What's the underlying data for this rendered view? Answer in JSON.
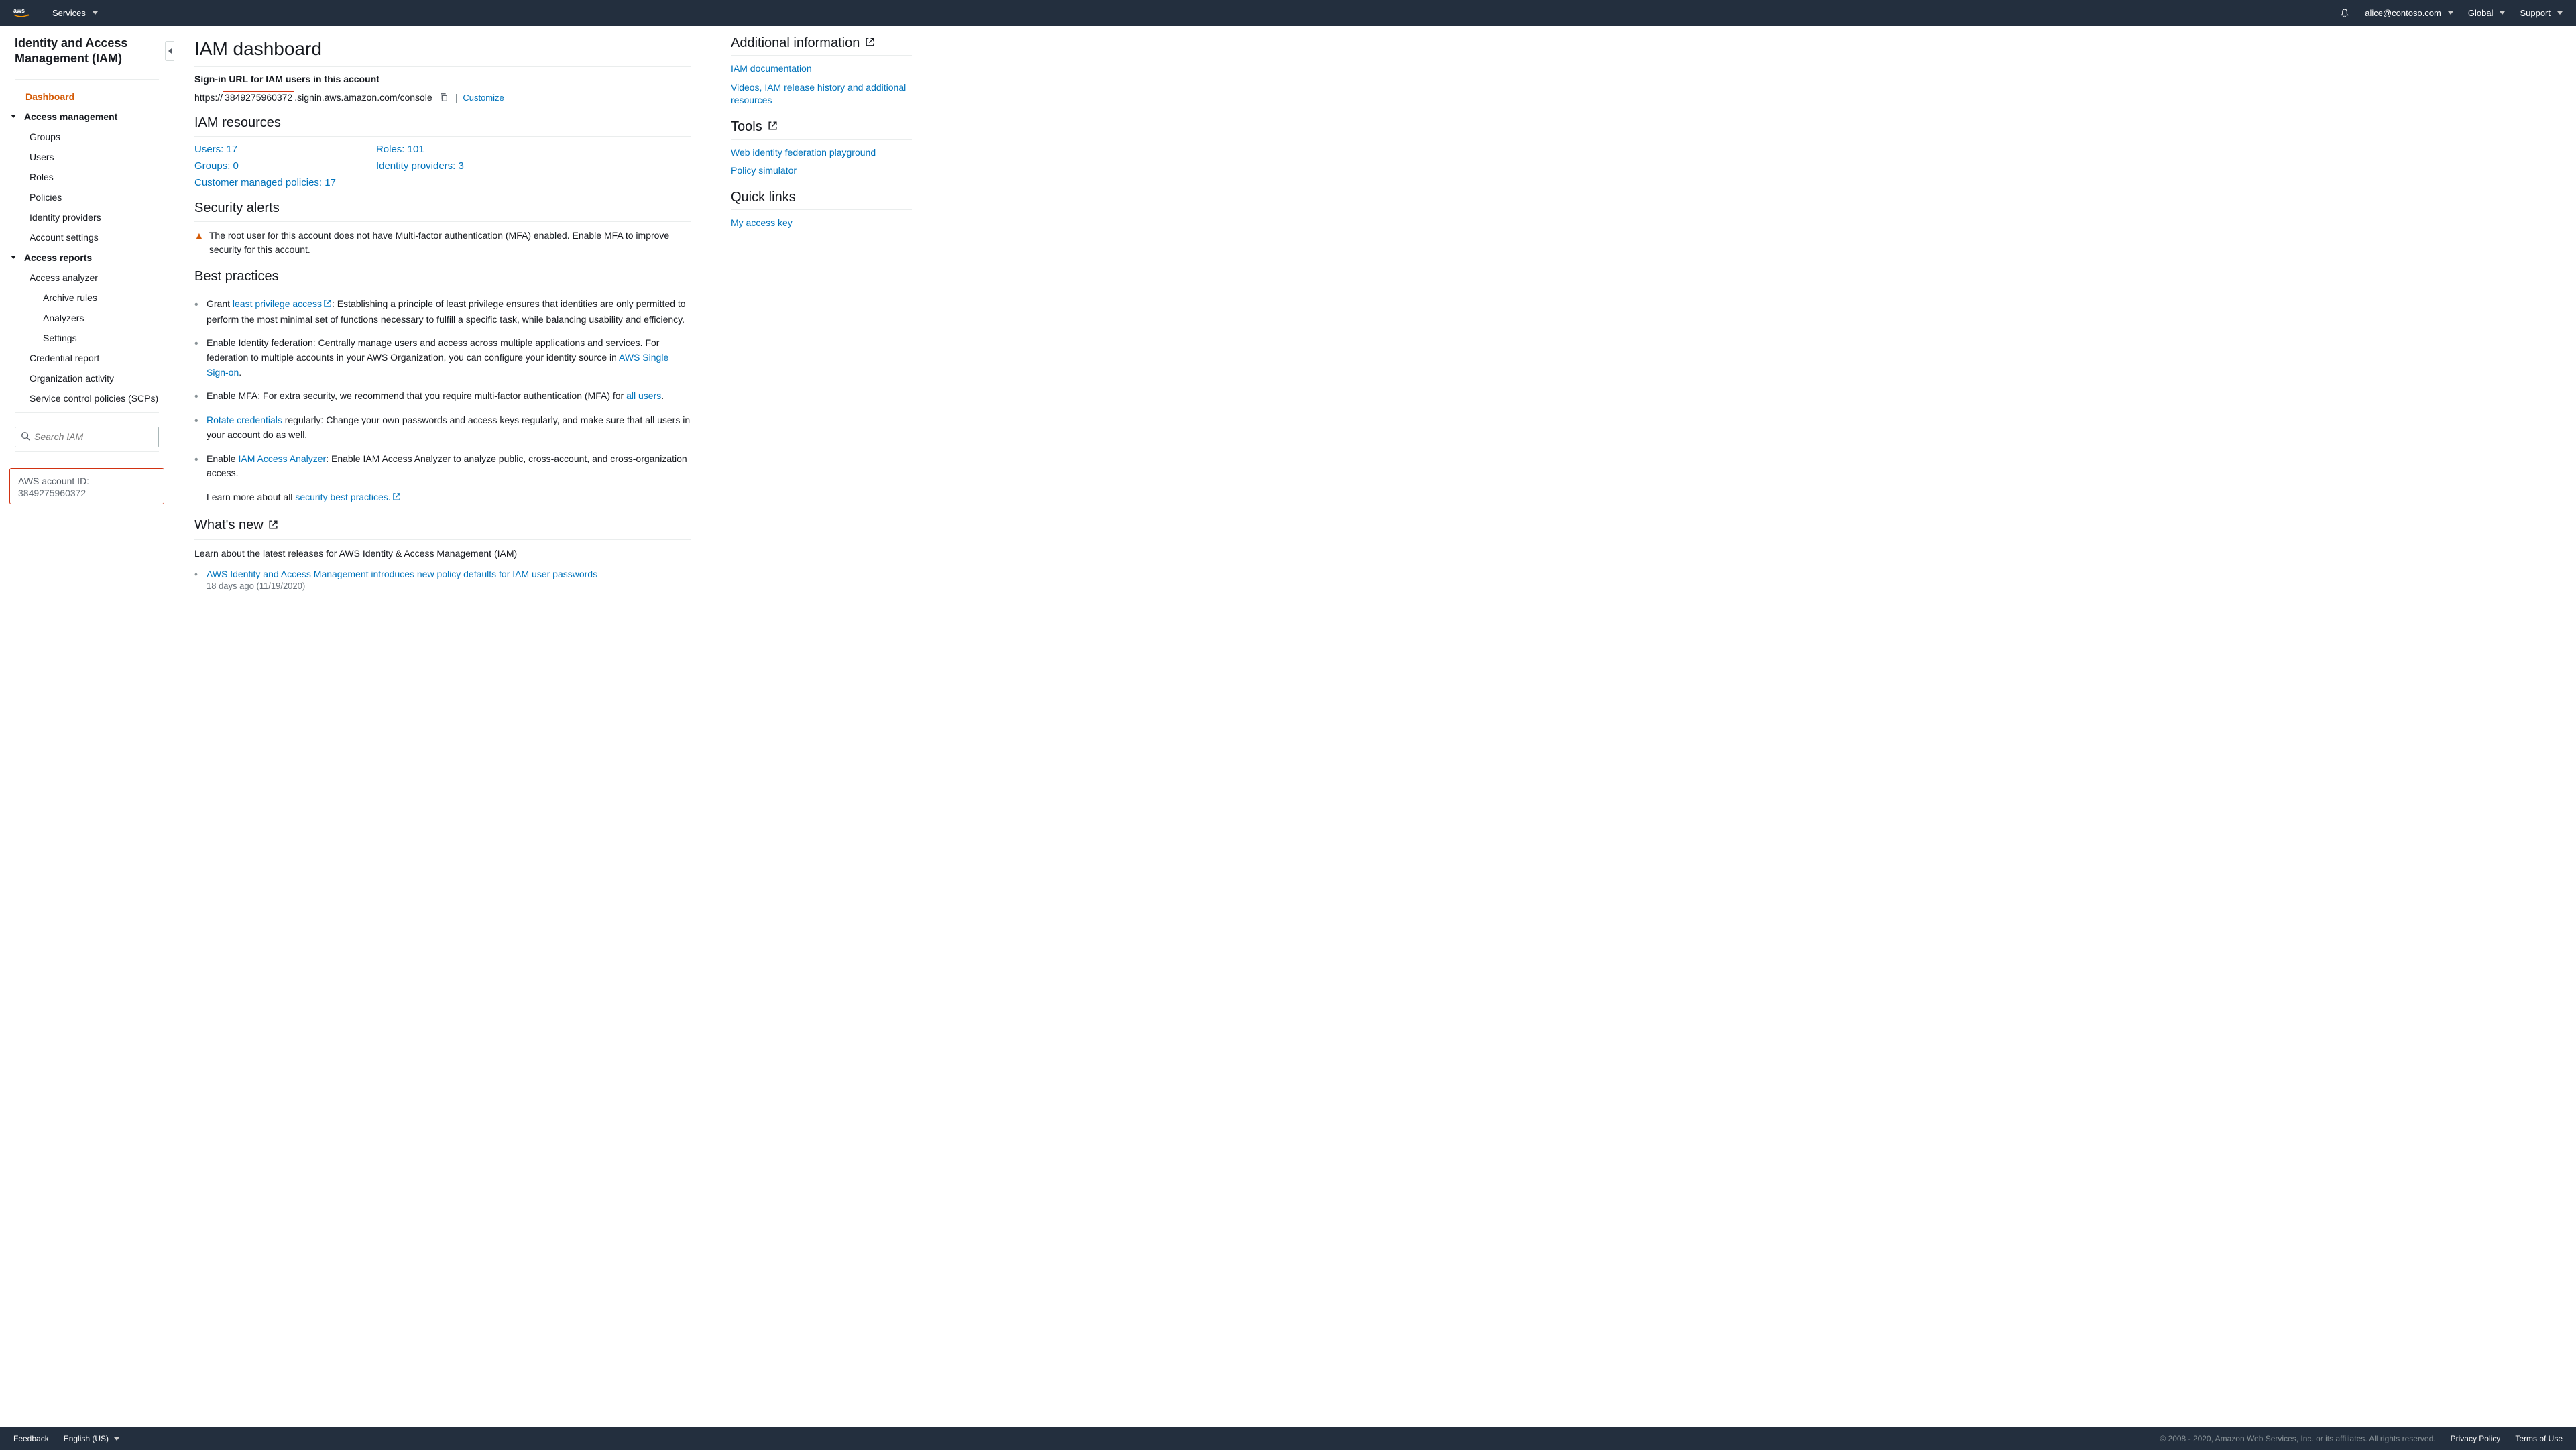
{
  "topbar": {
    "services": "Services",
    "user": "alice@contoso.com",
    "region": "Global",
    "support": "Support"
  },
  "sidebar": {
    "title": "Identity and Access Management (IAM)",
    "dashboard": "Dashboard",
    "group_access_mgmt": "Access management",
    "items_mgmt": {
      "groups": "Groups",
      "users": "Users",
      "roles": "Roles",
      "policies": "Policies",
      "idp": "Identity providers",
      "acct_settings": "Account settings"
    },
    "group_reports": "Access reports",
    "items_reports": {
      "analyzer": "Access analyzer",
      "archive_rules": "Archive rules",
      "analyzers": "Analyzers",
      "settings": "Settings",
      "cred_report": "Credential report",
      "org_activity": "Organization activity",
      "scp": "Service control policies (SCPs)"
    },
    "search_placeholder": "Search IAM",
    "account_id_label": "AWS account ID:",
    "account_id": "3849275960372"
  },
  "main": {
    "title": "IAM dashboard",
    "signin_label": "Sign-in URL for IAM users in this account",
    "signin_prefix": "https://",
    "signin_acct": "3849275960372",
    "signin_suffix": ".signin.aws.amazon.com/console",
    "customize": "Customize",
    "resources_heading": "IAM resources",
    "resources": {
      "users": "Users: 17",
      "groups": "Groups: 0",
      "cmp": "Customer managed policies: 17",
      "roles": "Roles: 101",
      "idp": "Identity providers: 3"
    },
    "security_alerts_heading": "Security alerts",
    "security_alert": "The root user for this account does not have Multi-factor authentication (MFA) enabled. Enable MFA to improve security for this account.",
    "best_practices_heading": "Best practices",
    "bp": {
      "b1_pre": "Grant ",
      "b1_link": "least privilege access",
      "b1_post": ": Establishing a principle of least privilege ensures that identities are only permitted to perform the most minimal set of functions necessary to fulfill a specific task, while balancing usability and efficiency.",
      "b2_pre": "Enable Identity federation: Centrally manage users and access across multiple applications and services. For federation to multiple accounts in your AWS Organization, you can configure your identity source in ",
      "b2_link": "AWS Single Sign-on",
      "b2_post": ".",
      "b3_pre": "Enable MFA: For extra security, we recommend that you require multi-factor authentication (MFA) for ",
      "b3_link": "all users",
      "b3_post": ".",
      "b4_link": "Rotate credentials",
      "b4_post": " regularly: Change your own passwords and access keys regularly, and make sure that all users in your account do as well.",
      "b5_pre": "Enable ",
      "b5_link": "IAM Access Analyzer",
      "b5_post": ": Enable IAM Access Analyzer to analyze public, cross-account, and cross-organization access.",
      "b6_pre": "Learn more about all ",
      "b6_link": "security best practices."
    },
    "whatsnew_heading": "What's new",
    "whatsnew_sub": "Learn about the latest releases for AWS Identity & Access Management (IAM)",
    "news1_title": "AWS Identity and Access Management introduces new policy defaults for IAM user passwords",
    "news1_date": "18 days ago (11/19/2020)"
  },
  "aside": {
    "addl_heading": "Additional information",
    "addl_links": {
      "doc": "IAM documentation",
      "videos": "Videos, IAM release history and additional resources"
    },
    "tools_heading": "Tools",
    "tools_links": {
      "playground": "Web identity federation playground",
      "sim": "Policy simulator"
    },
    "quick_heading": "Quick links",
    "quick_links": {
      "access_key": "My access key"
    }
  },
  "footer": {
    "feedback": "Feedback",
    "lang": "English (US)",
    "copyright": "© 2008 - 2020, Amazon Web Services, Inc. or its affiliates. All rights reserved.",
    "privacy": "Privacy Policy",
    "terms": "Terms of Use"
  }
}
